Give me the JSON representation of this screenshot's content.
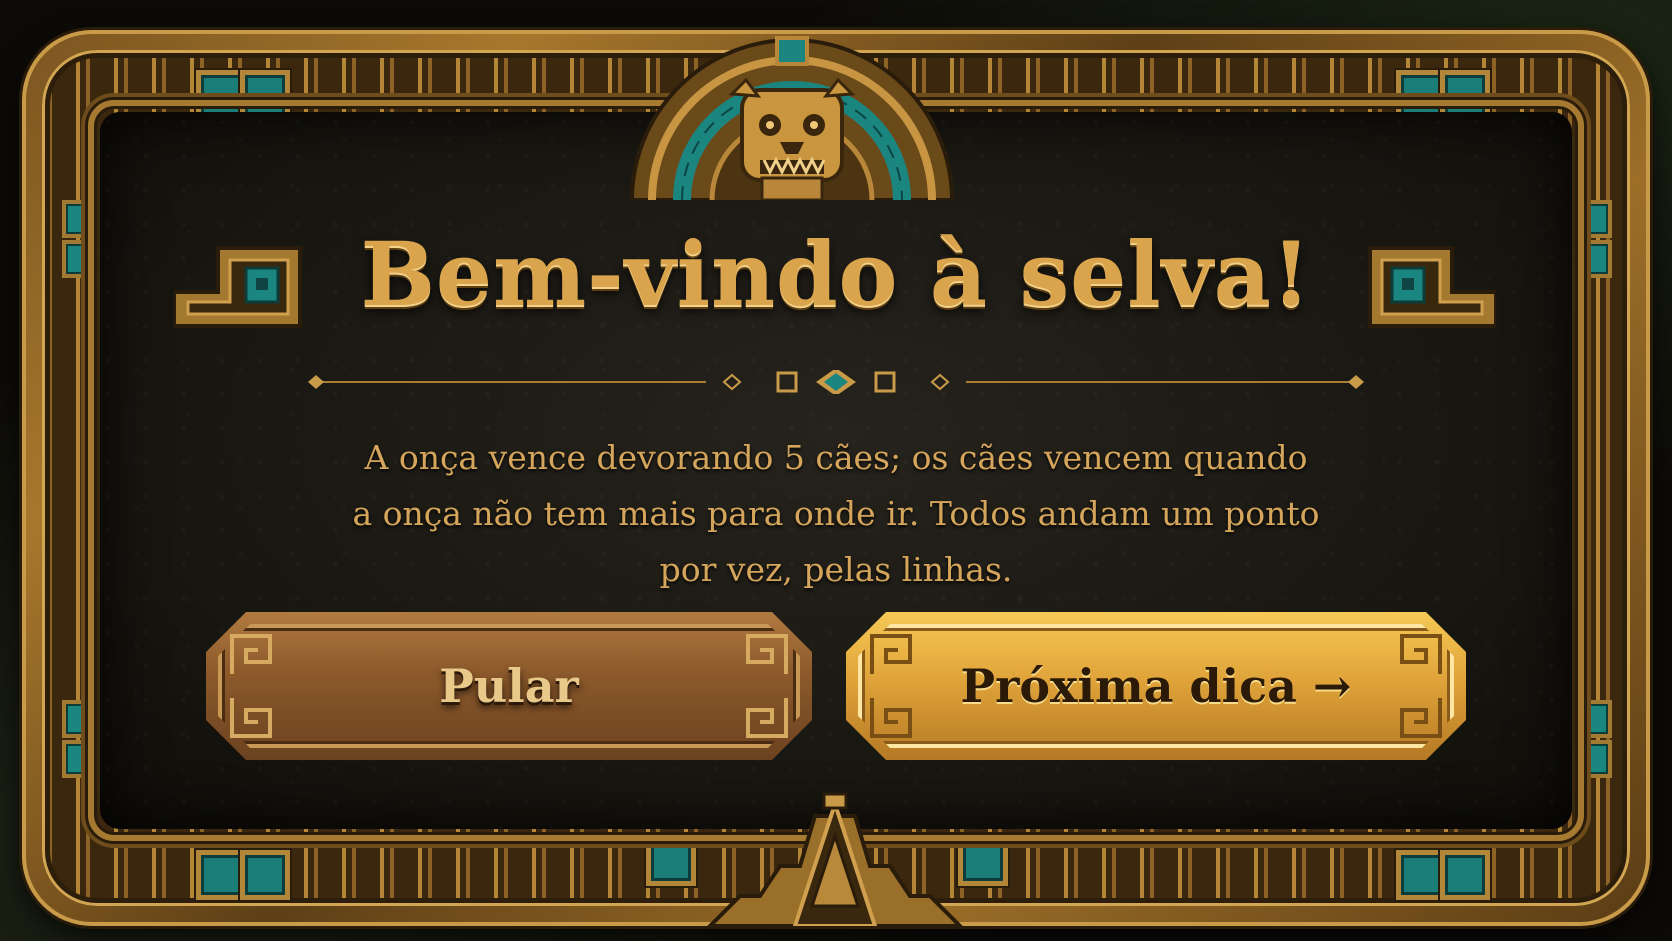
{
  "dialog": {
    "title": "Bem-vindo à selva!",
    "body_line1": "A onça vence devorando 5 cães; os cães vencem quando",
    "body_line2": "a onça não tem mais para onde ir. Todos andam um ponto",
    "body_line3": "por vez, pelas linhas."
  },
  "buttons": {
    "skip_label": "Pular",
    "next_label": "Próxima dica →"
  },
  "decor": {
    "top_ornament": "jaguar-mask-icon",
    "bottom_ornament": "stepped-pyramid-icon",
    "title_glyph_left": "stepped-glyph-icon",
    "title_glyph_right": "stepped-glyph-icon",
    "divider_gem": "turquoise-diamond-icon"
  },
  "colors": {
    "gold": "#d9a44b",
    "turquoise": "#1a7d78",
    "panel": "#17150f",
    "skip_button": "#8d5a2b",
    "next_button": "#e0a43a"
  }
}
